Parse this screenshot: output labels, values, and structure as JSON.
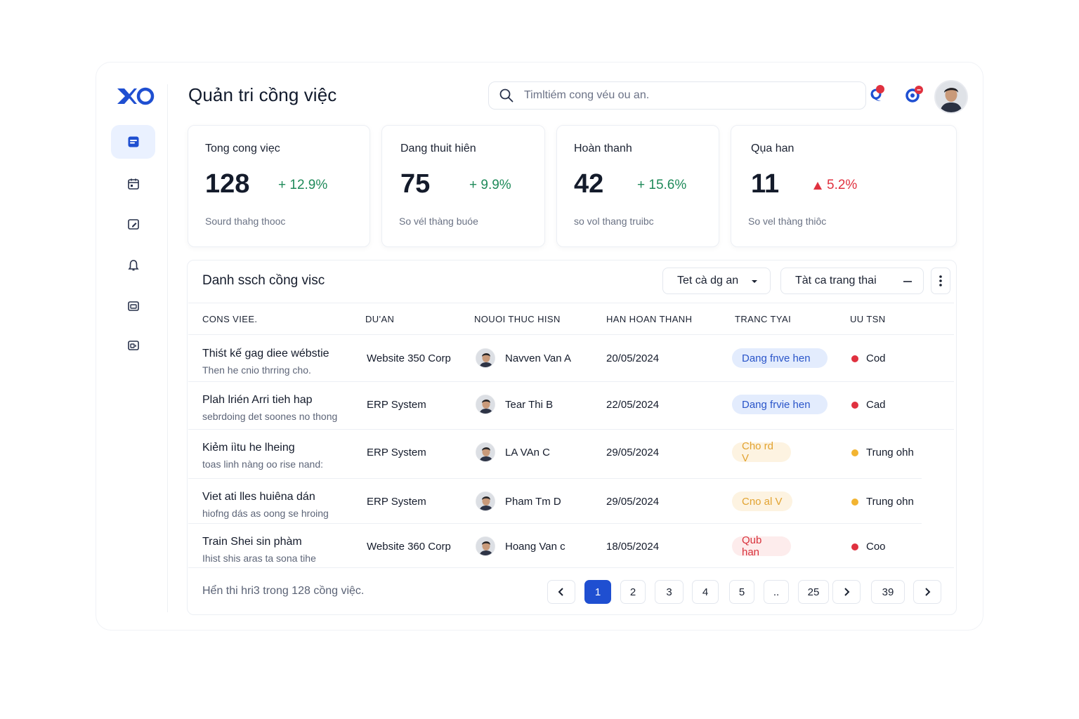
{
  "header": {
    "title": "Quản tri cồng việc",
    "search_placeholder": "Timltiém cong véu ou an."
  },
  "stats": [
    {
      "title": "Tong cong viẹc",
      "value": "128",
      "change": "+ 12.9%",
      "trend": "up",
      "sub": "Sourd thahg thooc"
    },
    {
      "title": "Dang thuit hiên",
      "value": "75",
      "change": "+ 9.9%",
      "trend": "up",
      "sub": "So vél thàng buóe"
    },
    {
      "title": "Hoàn thanh",
      "value": "42",
      "change": "+ 15.6%",
      "trend": "up",
      "sub": "so vol thang truibc"
    },
    {
      "title": "Qụa han",
      "value": "11",
      "change": "5.2%",
      "trend": "down",
      "sub": "So vel thàng thiôc"
    }
  ],
  "panel": {
    "title": "Danh ssch cồng visc",
    "filter_project": "Tet cà dg an",
    "filter_status": "Tàt ca trang thai"
  },
  "columns": [
    "CONS VIEE.",
    "DU'AN",
    "NOUOI THUC HISN",
    "HAN HOAN THANH",
    "TRANC TYAI",
    "UU TSN"
  ],
  "tasks": [
    {
      "name": "Thiśt kế gag diee wébstie",
      "desc": "Then he cnio thrring cho.",
      "project": "Website 350 Corp",
      "assignee": "Navven Van A",
      "due": "20/05/2024",
      "status": "Dang fnve hen",
      "status_type": "progress",
      "priority": "Cod",
      "priority_type": "high"
    },
    {
      "name": "Plah lrién Arri tieh hap",
      "desc": "sebrdoing det soones no thong",
      "project": "ERP System",
      "assignee": "Tear Thi B",
      "due": "22/05/2024",
      "status": "Dang frvie hen",
      "status_type": "progress",
      "priority": "Cad",
      "priority_type": "high"
    },
    {
      "name": "Kiẻm iìtu he lheing",
      "desc": "toas linh nàng oo rise nand:",
      "project": "ERP System",
      "assignee": "LA VAn C",
      "due": "29/05/2024",
      "status": "Cho rd V",
      "status_type": "waiting",
      "priority": "Trung ohh",
      "priority_type": "medium"
    },
    {
      "name": "Viet ati lles huiêna dán",
      "desc": "hiofng dás as oong se hroing",
      "project": "ERP System",
      "assignee": "Pham Tm D",
      "due": "29/05/2024",
      "status": "Cno al V",
      "status_type": "waiting",
      "priority": "Trung ohn",
      "priority_type": "medium"
    },
    {
      "name": "Train Shei sin phàm",
      "desc": "Ihist shis aras ta sona tihe",
      "project": "Website 360 Corp",
      "assignee": "Hoang Van c",
      "due": "18/05/2024",
      "status": "Qub han",
      "status_type": "overdue",
      "priority": "Coo",
      "priority_type": "high"
    }
  ],
  "pagination": {
    "info": "Hển thi hri3 trong 128 cồng việc.",
    "pages": [
      "1",
      "2",
      "3",
      "4",
      "5",
      "..",
      "25",
      "39"
    ],
    "current": "1"
  },
  "colors": {
    "accent": "#1f4fd1",
    "up": "#1f8a5a",
    "down": "#e0313f",
    "progress_bg": "#e3ecfd",
    "progress_fg": "#2a55c9",
    "waiting_bg": "#fdf3e1",
    "waiting_fg": "#e2a331",
    "overdue_bg": "#fdecec",
    "overdue_fg": "#d8323c",
    "prio_high": "#e0313f",
    "prio_medium": "#f2b431"
  }
}
